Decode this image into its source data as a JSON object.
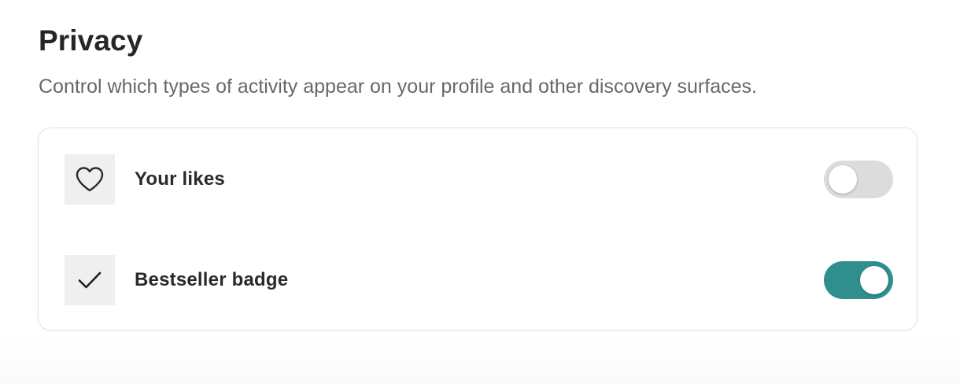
{
  "privacy": {
    "title": "Privacy",
    "description": "Control which types of activity appear on your profile and other discovery surfaces."
  },
  "settings": [
    {
      "label": "Your likes",
      "icon": "heart-icon",
      "enabled": false
    },
    {
      "label": "Bestseller badge",
      "icon": "checkmark-icon",
      "enabled": true
    }
  ],
  "colors": {
    "toggle_on": "#2f8f8f",
    "toggle_off": "#dcdcdc",
    "icon_tile": "#efefef"
  }
}
